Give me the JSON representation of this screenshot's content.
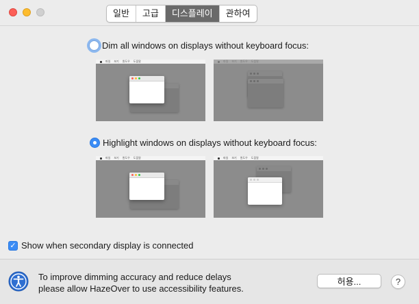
{
  "window": {
    "tabs": [
      {
        "label": "일반",
        "active": false
      },
      {
        "label": "고급",
        "active": false
      },
      {
        "label": "디스플레이",
        "active": true
      },
      {
        "label": "관하여",
        "active": false
      }
    ]
  },
  "options": {
    "dim": {
      "label": "Dim all windows on displays without keyboard focus:",
      "selected": false
    },
    "highlight": {
      "label": "Highlight windows on displays without keyboard focus:",
      "selected": true
    }
  },
  "preview_menu": [
    "파일",
    "보기",
    "윈도우",
    "도움말"
  ],
  "checkbox": {
    "label": "Show when secondary display is connected",
    "checked": true,
    "mark": "✓"
  },
  "footer": {
    "line1": "To improve dimming accuracy and reduce delays",
    "line2": "please allow HazeOver to use accessibility features.",
    "allow_button": "허용...",
    "help_button": "?"
  },
  "colors": {
    "accent": "#3b8cf5",
    "preview_bg": "#8c8c8c"
  }
}
